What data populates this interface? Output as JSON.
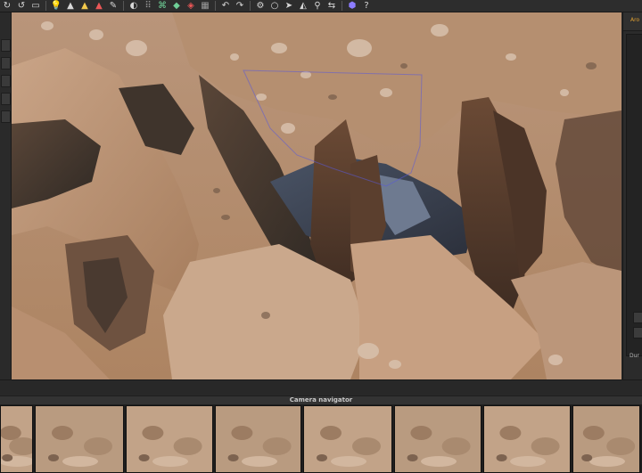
{
  "toolbar": {
    "icons": [
      {
        "name": "rotate-cw-icon",
        "glyph": "↻",
        "tone": ""
      },
      {
        "name": "rotate-ccw-icon",
        "glyph": "↺",
        "tone": ""
      },
      {
        "name": "panel-toggle-icon",
        "glyph": "▭",
        "tone": ""
      },
      {
        "name": "light-bulb-icon",
        "glyph": "💡",
        "tone": "c-yellow"
      },
      {
        "name": "sparse-cloud-icon",
        "glyph": "▲",
        "tone": ""
      },
      {
        "name": "dense-cloud-icon",
        "glyph": "▲",
        "tone": "c-yellow"
      },
      {
        "name": "colored-mesh-icon",
        "glyph": "▲",
        "tone": "c-red"
      },
      {
        "name": "brush-icon",
        "glyph": "✎",
        "tone": ""
      },
      {
        "name": "paint-bucket-icon",
        "glyph": "◐",
        "tone": ""
      },
      {
        "name": "grid-points-icon",
        "glyph": "⠿",
        "tone": "c-grey"
      },
      {
        "name": "mesh-wire-icon",
        "glyph": "⌘",
        "tone": "c-green"
      },
      {
        "name": "mesh-solid-icon",
        "glyph": "◆",
        "tone": "c-green"
      },
      {
        "name": "texture-icon",
        "glyph": "◈",
        "tone": "c-red"
      },
      {
        "name": "frame-icon",
        "glyph": "▦",
        "tone": "c-grey"
      },
      {
        "name": "undo-icon",
        "glyph": "↶",
        "tone": ""
      },
      {
        "name": "redo-icon",
        "glyph": "↷",
        "tone": ""
      },
      {
        "name": "gear-icon",
        "glyph": "⚙",
        "tone": ""
      },
      {
        "name": "circle-select-icon",
        "glyph": "○",
        "tone": ""
      },
      {
        "name": "pointer-icon",
        "glyph": "➤",
        "tone": ""
      },
      {
        "name": "measure-icon",
        "glyph": "◭",
        "tone": ""
      },
      {
        "name": "pin-icon",
        "glyph": "⚲",
        "tone": ""
      },
      {
        "name": "transform-icon",
        "glyph": "⇆",
        "tone": ""
      },
      {
        "name": "cube-icon",
        "glyph": "⬢",
        "tone": "c-cube"
      },
      {
        "name": "help-icon",
        "glyph": "?",
        "tone": ""
      }
    ]
  },
  "right_panel": {
    "title": "Aro",
    "footer_label": "Dur"
  },
  "camera_navigator": {
    "title": "Camera navigator",
    "thumbnails": [
      {
        "label": "thumb-1"
      },
      {
        "label": "thumb-2"
      },
      {
        "label": "thumb-3"
      },
      {
        "label": "thumb-4"
      },
      {
        "label": "thumb-5"
      },
      {
        "label": "thumb-6"
      },
      {
        "label": "thumb-7"
      },
      {
        "label": "thumb-8"
      }
    ]
  },
  "colors": {
    "accent": "#e0a030",
    "selection_box": "#5a5ad8"
  }
}
